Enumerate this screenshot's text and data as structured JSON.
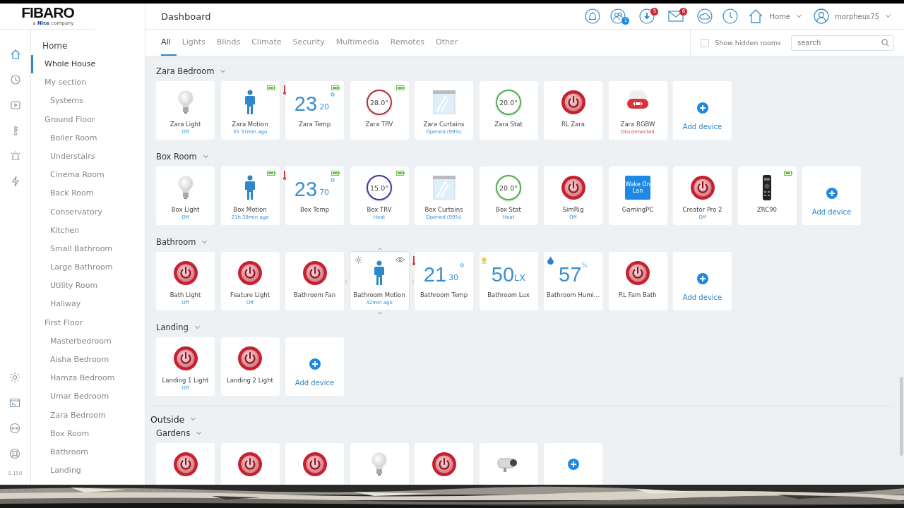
{
  "logo": {
    "brand": "FIBARO",
    "tagline_pre": "a ",
    "tagline_brand": "Nice",
    "tagline_post": " company"
  },
  "header": {
    "title": "Dashboard",
    "badges": [
      {
        "count": "1",
        "color": "#1e88e5"
      },
      {
        "count": "5",
        "color": "#c62838"
      },
      {
        "count": "6",
        "color": "#c62838"
      }
    ],
    "location": "Home",
    "user": "morpheus75"
  },
  "rail": {
    "top": [
      {
        "selected": true
      },
      {
        "selected": false
      },
      {
        "selected": false
      },
      {
        "selected": false
      },
      {
        "selected": false
      },
      {
        "selected": false
      }
    ],
    "version": "5.150"
  },
  "sidebar": {
    "title": "Home",
    "items": [
      {
        "label": "Whole House",
        "selected": true
      },
      {
        "label": "My section",
        "selected": false,
        "children": [
          {
            "label": "Systems",
            "selected": false
          }
        ]
      },
      {
        "label": "Ground Floor",
        "selected": false,
        "children": [
          {
            "label": "Boiler Room",
            "selected": false
          },
          {
            "label": "Understairs",
            "selected": false
          },
          {
            "label": "Cinema Room",
            "selected": false
          },
          {
            "label": "Back Room",
            "selected": false
          },
          {
            "label": "Conservatory",
            "selected": false
          },
          {
            "label": "Kitchen",
            "selected": false
          },
          {
            "label": "Small Bathroom",
            "selected": false
          },
          {
            "label": "Large Bathroom",
            "selected": false
          },
          {
            "label": "Utility Room",
            "selected": false
          },
          {
            "label": "Hallway",
            "selected": false
          }
        ]
      },
      {
        "label": "First Floor",
        "selected": false,
        "children": [
          {
            "label": "Masterbedroom",
            "selected": false
          },
          {
            "label": "Aisha Bedroom",
            "selected": false
          },
          {
            "label": "Hamza Bedroom",
            "selected": false
          },
          {
            "label": "Umar Bedroom",
            "selected": false
          },
          {
            "label": "Zara Bedroom",
            "selected": false
          },
          {
            "label": "Box Room",
            "selected": false
          },
          {
            "label": "Bathroom",
            "selected": false
          },
          {
            "label": "Landing",
            "selected": false
          }
        ]
      }
    ]
  },
  "tabs": [
    {
      "label": "All",
      "selected": true
    },
    {
      "label": "Lights",
      "selected": false
    },
    {
      "label": "Blinds",
      "selected": false
    },
    {
      "label": "Climate",
      "selected": false
    },
    {
      "label": "Security",
      "selected": false
    },
    {
      "label": "Multimedia",
      "selected": false
    },
    {
      "label": "Remotes",
      "selected": false
    },
    {
      "label": "Other",
      "selected": false
    }
  ],
  "show_hidden_rooms": {
    "label": "Show hidden rooms",
    "checked": false
  },
  "search": {
    "placeholder": "search"
  },
  "sections": [
    {
      "kind": "room",
      "title": "Zara Bedroom",
      "devices": [
        {
          "kind": "bulb",
          "name": "Zara Light",
          "status": "Off"
        },
        {
          "kind": "motion",
          "name": "Zara Motion",
          "status": "3h 37min ago",
          "battery": true
        },
        {
          "kind": "temperature",
          "name": "Zara Temp",
          "value": "23",
          "decimal": "20",
          "battery": true
        },
        {
          "kind": "dial",
          "name": "Zara TRV",
          "value": "28.0°",
          "color": "#b0303c",
          "battery": true
        },
        {
          "kind": "curtains",
          "name": "Zara Curtains",
          "status": "Opened (99%)"
        },
        {
          "kind": "dial",
          "name": "Zara Stat",
          "value": "20.0°",
          "color": "#4caf50"
        },
        {
          "kind": "power",
          "name": "RL Zara"
        },
        {
          "kind": "rgbw",
          "name": "Zara RGBW",
          "status": "Disconnected",
          "disconnected": true
        },
        {
          "kind": "add",
          "name": "Add device"
        }
      ]
    },
    {
      "kind": "room",
      "title": "Box Room",
      "devices": [
        {
          "kind": "bulb",
          "name": "Box Light",
          "status": "Off"
        },
        {
          "kind": "motion",
          "name": "Box Motion",
          "status": "21h 38min ago",
          "battery": true
        },
        {
          "kind": "temperature",
          "name": "Box Temp",
          "value": "23",
          "decimal": "70",
          "battery": true
        },
        {
          "kind": "dial",
          "name": "Box TRV",
          "value": "15.0°",
          "color": "#3f3aa0",
          "status": "Heat",
          "battery": true
        },
        {
          "kind": "curtains",
          "name": "Box Curtains",
          "status": "Opened (99%)"
        },
        {
          "kind": "dial",
          "name": "Box Stat",
          "value": "20.0°",
          "color": "#4caf50",
          "status": "Heat"
        },
        {
          "kind": "power",
          "name": "SimRig",
          "status": "Off"
        },
        {
          "kind": "app",
          "name": "GamingPC",
          "app_label": "Wake On Lan"
        },
        {
          "kind": "power",
          "name": "Creator Pro 2",
          "status": "Off"
        },
        {
          "kind": "remote",
          "name": "ZRC90",
          "battery": true
        },
        {
          "kind": "add",
          "name": "Add device"
        }
      ]
    },
    {
      "kind": "room",
      "title": "Bathroom",
      "devices": [
        {
          "kind": "power",
          "name": "Bath Light",
          "status": "Off"
        },
        {
          "kind": "power",
          "name": "Feature Light",
          "status": "Off"
        },
        {
          "kind": "power",
          "name": "Bathroom Fan"
        },
        {
          "kind": "motion",
          "name": "Bathroom Motion",
          "status": "42min ago",
          "hovered": true
        },
        {
          "kind": "temperature",
          "name": "Bathroom Temp",
          "value": "21",
          "decimal": "30"
        },
        {
          "kind": "lux",
          "name": "Bathroom Lux",
          "value": "50",
          "unit": "LX"
        },
        {
          "kind": "humidity",
          "name": "Bathroom Humi...",
          "value": "57",
          "unit": "%"
        },
        {
          "kind": "power",
          "name": "RL Fam Bath"
        },
        {
          "kind": "add",
          "name": "Add device"
        }
      ]
    },
    {
      "kind": "room",
      "title": "Landing",
      "devices": [
        {
          "kind": "power",
          "name": "Landing 1 Light",
          "status": "Off"
        },
        {
          "kind": "power",
          "name": "Landing 2 Light"
        },
        {
          "kind": "add",
          "name": "Add device"
        }
      ]
    },
    {
      "kind": "floor",
      "title": "Outside"
    },
    {
      "kind": "room",
      "title": "Gardens",
      "devices": [
        {
          "kind": "power"
        },
        {
          "kind": "power"
        },
        {
          "kind": "power"
        },
        {
          "kind": "bulb"
        },
        {
          "kind": "power"
        },
        {
          "kind": "camera"
        },
        {
          "kind": "add"
        }
      ]
    }
  ]
}
